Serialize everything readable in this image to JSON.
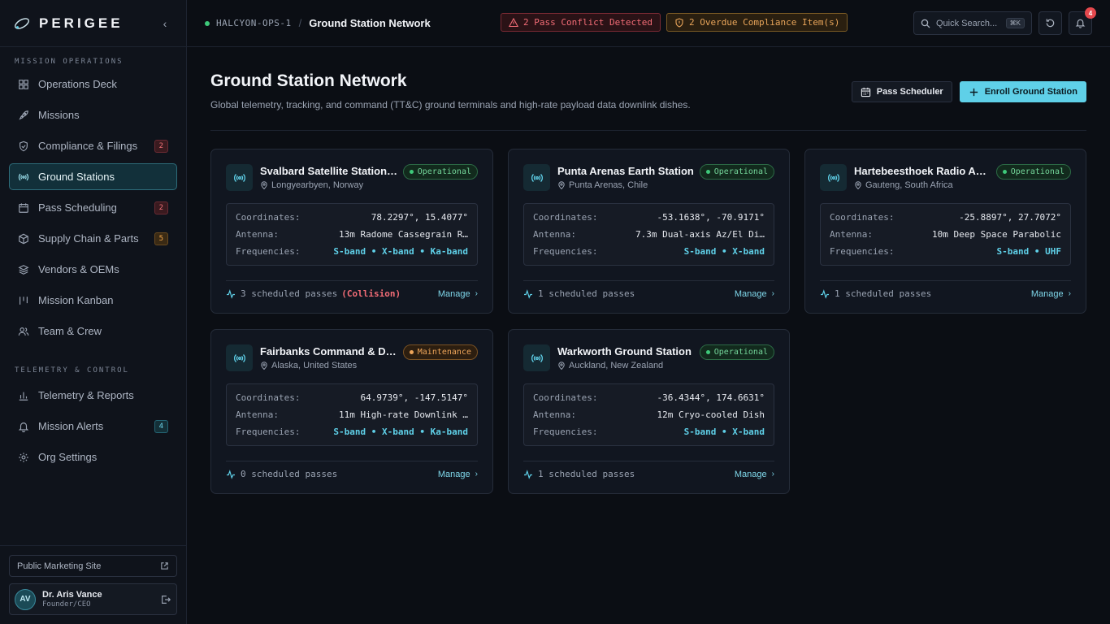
{
  "brand": {
    "name": "PERIGEE"
  },
  "sidebar": {
    "sections": [
      {
        "label": "MISSION OPERATIONS"
      },
      {
        "label": "TELEMETRY & CONTROL"
      }
    ],
    "items": [
      {
        "label": "Operations Deck",
        "badge": ""
      },
      {
        "label": "Missions",
        "badge": ""
      },
      {
        "label": "Compliance & Filings",
        "badge": "2"
      },
      {
        "label": "Ground Stations",
        "badge": ""
      },
      {
        "label": "Pass Scheduling",
        "badge": "2"
      },
      {
        "label": "Supply Chain & Parts",
        "badge": "5"
      },
      {
        "label": "Vendors & OEMs",
        "badge": ""
      },
      {
        "label": "Mission Kanban",
        "badge": ""
      },
      {
        "label": "Team & Crew",
        "badge": ""
      },
      {
        "label": "Telemetry & Reports",
        "badge": ""
      },
      {
        "label": "Mission Alerts",
        "badge": "4"
      },
      {
        "label": "Org Settings",
        "badge": ""
      }
    ],
    "marketing_link": "Public Marketing Site",
    "user": {
      "initials": "AV",
      "name": "Dr. Aris Vance",
      "role": "Founder/CEO"
    }
  },
  "topbar": {
    "environment": "HALCYON-OPS-1",
    "breadcrumb_sep": "/",
    "page": "Ground Station Network",
    "alert_conflict": "2 Pass Conflict Detected",
    "alert_compliance": "2 Overdue Compliance Item(s)",
    "search_placeholder": "Quick Search...",
    "search_shortcut": "⌘K",
    "notification_count": "4"
  },
  "page": {
    "title": "Ground Station Network",
    "subtitle": "Global telemetry, tracking, and command (TT&C) ground terminals and high-rate payload data downlink dishes.",
    "btn_scheduler": "Pass Scheduler",
    "btn_enroll": "Enroll Ground Station"
  },
  "labels": {
    "coordinates": "Coordinates:",
    "antenna": "Antenna:",
    "frequencies": "Frequencies:",
    "manage": "Manage"
  },
  "stations": [
    {
      "name": "Svalbard Satellite Station (...",
      "location": "Longyearbyen, Norway",
      "status": "Operational",
      "coordinates": "78.2297°, 15.4077°",
      "antenna": "13m Radome Cassegrain R…",
      "frequencies": "S-band • X-band • Ka-band",
      "passes": "3 scheduled passes",
      "note": "(Collision)"
    },
    {
      "name": "Punta Arenas Earth Station",
      "location": "Punta Arenas, Chile",
      "status": "Operational",
      "coordinates": "-53.1638°, -70.9171°",
      "antenna": "7.3m Dual-axis Az/El Di…",
      "frequencies": "S-band • X-band",
      "passes": "1 scheduled passes",
      "note": ""
    },
    {
      "name": "Hartebeesthoek Radio Ast...",
      "location": "Gauteng, South Africa",
      "status": "Operational",
      "coordinates": "-25.8897°, 27.7072°",
      "antenna": "10m Deep Space Parabolic",
      "frequencies": "S-band • UHF",
      "passes": "1 scheduled passes",
      "note": ""
    },
    {
      "name": "Fairbanks Command & Da...",
      "location": "Alaska, United States",
      "status": "Maintenance",
      "coordinates": "64.9739°, -147.5147°",
      "antenna": "11m High-rate Downlink …",
      "frequencies": "S-band • X-band • Ka-band",
      "passes": "0 scheduled passes",
      "note": ""
    },
    {
      "name": "Warkworth Ground Station",
      "location": "Auckland, New Zealand",
      "status": "Operational",
      "coordinates": "-36.4344°, 174.6631°",
      "antenna": "12m Cryo-cooled Dish",
      "frequencies": "S-band • X-band",
      "passes": "1 scheduled passes",
      "note": ""
    }
  ],
  "colors": {
    "accent": "#5fd0e8",
    "operational": "#3ec97a",
    "maintenance": "#eea55a",
    "danger": "#f26c76"
  }
}
